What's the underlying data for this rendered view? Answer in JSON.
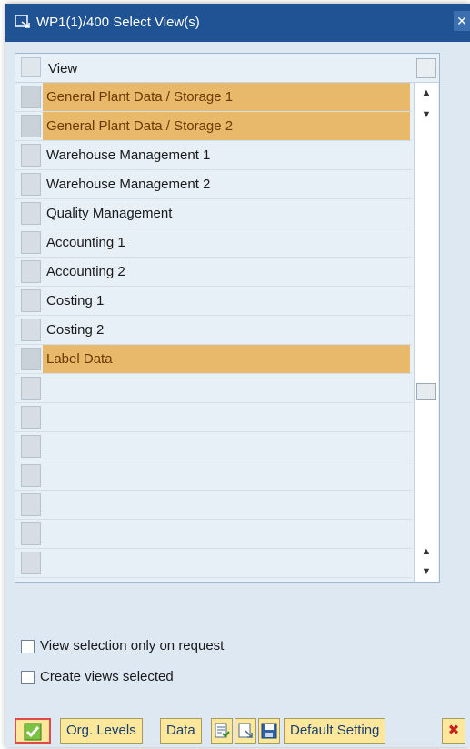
{
  "window": {
    "title": "WP1(1)/400 Select View(s)",
    "close_glyph": "✕"
  },
  "table": {
    "column_header": "View",
    "rows": [
      {
        "label": "General Plant Data / Storage 1",
        "selected": true
      },
      {
        "label": "General Plant Data / Storage 2",
        "selected": true
      },
      {
        "label": "Warehouse Management 1",
        "selected": false
      },
      {
        "label": "Warehouse Management 2",
        "selected": false
      },
      {
        "label": "Quality Management",
        "selected": false
      },
      {
        "label": "Accounting 1",
        "selected": false
      },
      {
        "label": "Accounting 2",
        "selected": false
      },
      {
        "label": "Costing 1",
        "selected": false
      },
      {
        "label": "Costing 2",
        "selected": false
      },
      {
        "label": "Label Data",
        "selected": true
      },
      {
        "label": "",
        "selected": false
      },
      {
        "label": "",
        "selected": false
      },
      {
        "label": "",
        "selected": false
      },
      {
        "label": "",
        "selected": false
      },
      {
        "label": "",
        "selected": false
      },
      {
        "label": "",
        "selected": false
      },
      {
        "label": "",
        "selected": false
      }
    ]
  },
  "options": {
    "view_on_request": {
      "label": "View selection only on request",
      "checked": false
    },
    "create_selected": {
      "label": "Create views selected",
      "checked": false
    }
  },
  "toolbar": {
    "org_levels": "Org. Levels",
    "data": "Data",
    "default_setting": "Default Setting"
  },
  "icons": {
    "ok": "check-icon",
    "select_all": "select-all-icon",
    "deselect_all": "deselect-all-icon",
    "save": "save-icon",
    "cancel": "cancel-icon"
  },
  "colors": {
    "title_bar": "#1f5393",
    "selected_row": "#e8b96b",
    "selected_text": "#6b3a00",
    "toolbar_button": "#fde79a"
  }
}
